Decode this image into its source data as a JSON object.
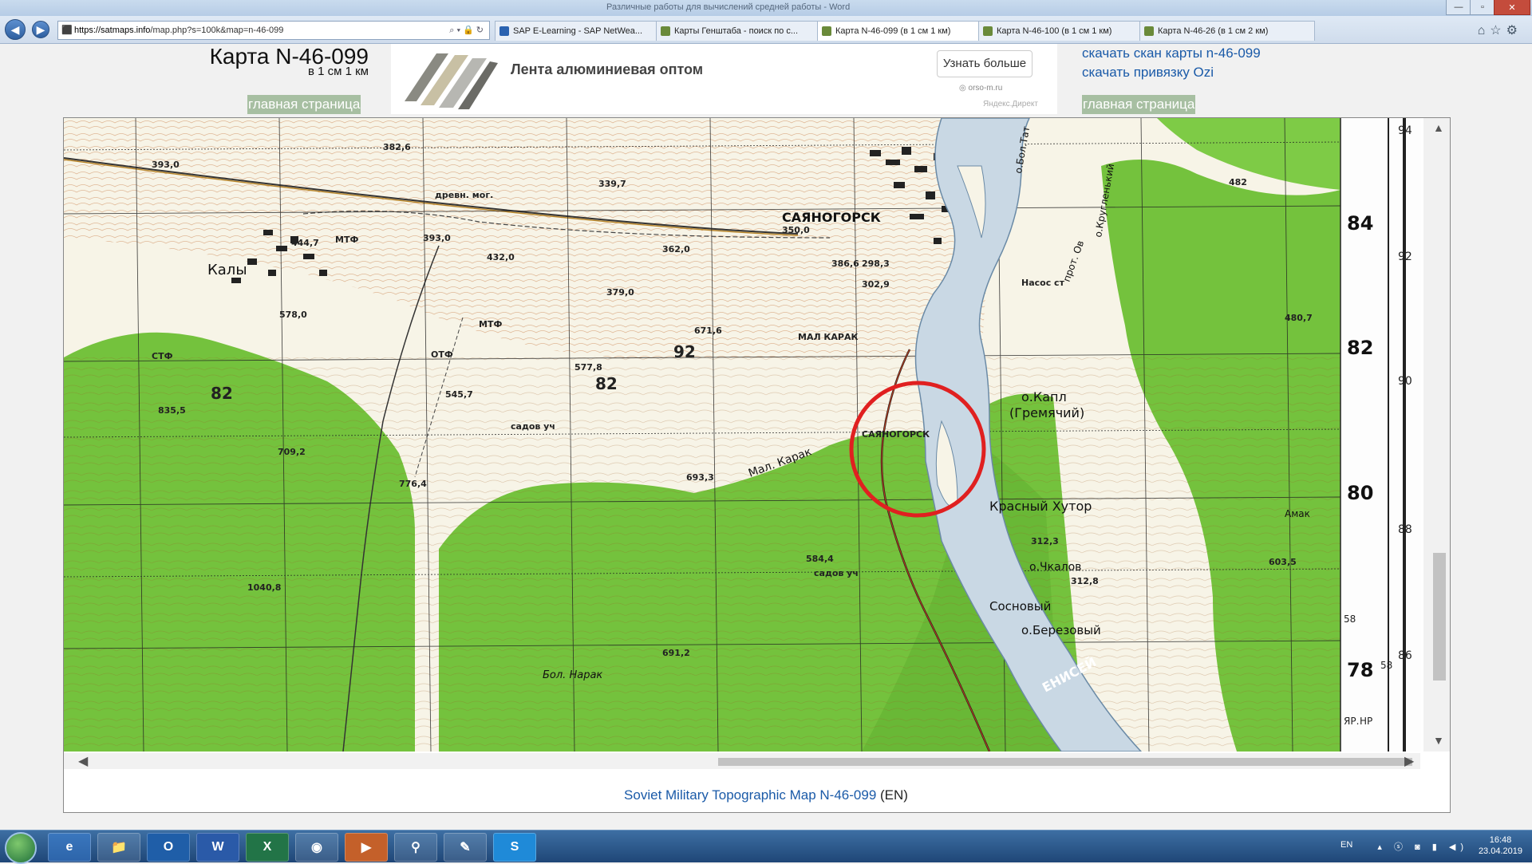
{
  "window": {
    "title": "Различные работы для вычислений средней работы - Word"
  },
  "browser": {
    "url_prefix": "https://satmaps.info",
    "url_rest": "/map.php?s=100k&map=n-46-099",
    "tabs": [
      {
        "label": "SAP E-Learning - SAP NetWea..."
      },
      {
        "label": "Карты Генштаба - поиск по с..."
      },
      {
        "label": "Карта N-46-099 (в 1 см 1 км)"
      },
      {
        "label": "Карта N-46-100 (в 1 см 1 км)"
      },
      {
        "label": "Карта N-46-26 (в 1 см 2 км)"
      }
    ],
    "tab_close": "×"
  },
  "page": {
    "title": "Карта N-46-099",
    "scale": "в 1 см 1 км",
    "home_link": "главная страница",
    "ad": {
      "text": "Лента алюминиевая оптом",
      "button": "Узнать больше",
      "domain": "orso-m.ru",
      "source": "Яндекс.Директ"
    },
    "download_scan": "скачать скан карты n-46-099",
    "download_ozi": "скачать привязку Ozi",
    "footer_link": "Soviet Military Topographic Map N-46-099",
    "footer_suffix": " (EN)"
  },
  "map": {
    "labels": {
      "town_main": "САЯНОГОРСК",
      "town_kaly": "Калы",
      "khutor": "Красный Хутор",
      "island_kapl": "о.Капл",
      "island_grem": "(Гремячий)",
      "island_chkl": "о.Чкалов",
      "island_sosn": "Сосновый",
      "island_ber": "о.Березовый",
      "river_label": "ЕНИСЕЙ",
      "mal_karak": "Мал. Карак",
      "mal_karak2": "МАЛ КАРАК",
      "bol_narak": "Бол. Нарак",
      "mtf": "МТФ",
      "otf": "ОТФ",
      "stf": "СТФ",
      "sadov": "садов уч",
      "sadov2": "садов уч",
      "dreln": "древн. мог.",
      "sayanog_small": "САЯНОГОРСК",
      "nasos": "Насос ст",
      "prot": "прот. Ов",
      "kruglenkiy": "о.Кругленький",
      "bol_tat": "о.Бол.Тат",
      "amak": "Амак"
    },
    "heights": [
      "393,0",
      "382,6",
      "339,7",
      "350,0",
      "432,0",
      "393,0",
      "444,7",
      "362,0",
      "386,6",
      "379,0",
      "302,9",
      "298,3",
      "578,0",
      "671,6",
      "577,8",
      "545,7",
      "835,5",
      "709,2",
      "776,4",
      "693,3",
      "584,4",
      "1040,8",
      "691,2",
      "312,3",
      "312,8",
      "603,5",
      "480,7",
      "482"
    ],
    "grid_numbers_right": [
      "84",
      "82",
      "80",
      "78"
    ],
    "grid_numbers_inner": [
      "82",
      "82",
      "92"
    ],
    "sheet_numbers": [
      "94",
      "92",
      "90",
      "88",
      "86"
    ],
    "corner_labels": [
      "58",
      "58",
      "НР",
      "ЯР."
    ]
  },
  "taskbar": {
    "apps": [
      "e",
      "📁",
      "O",
      "W",
      "X",
      "◉",
      "▶",
      "⚲",
      "✎",
      "S"
    ],
    "lang": "EN",
    "time": "16:48",
    "date": "23.04.2019"
  },
  "colors": {
    "forest": "#74c23d",
    "clearing": "#f7f4e7",
    "contour": "#b3622e",
    "river": "#c9d8e4",
    "circle": "#e02020",
    "link": "#1a5aa8"
  }
}
